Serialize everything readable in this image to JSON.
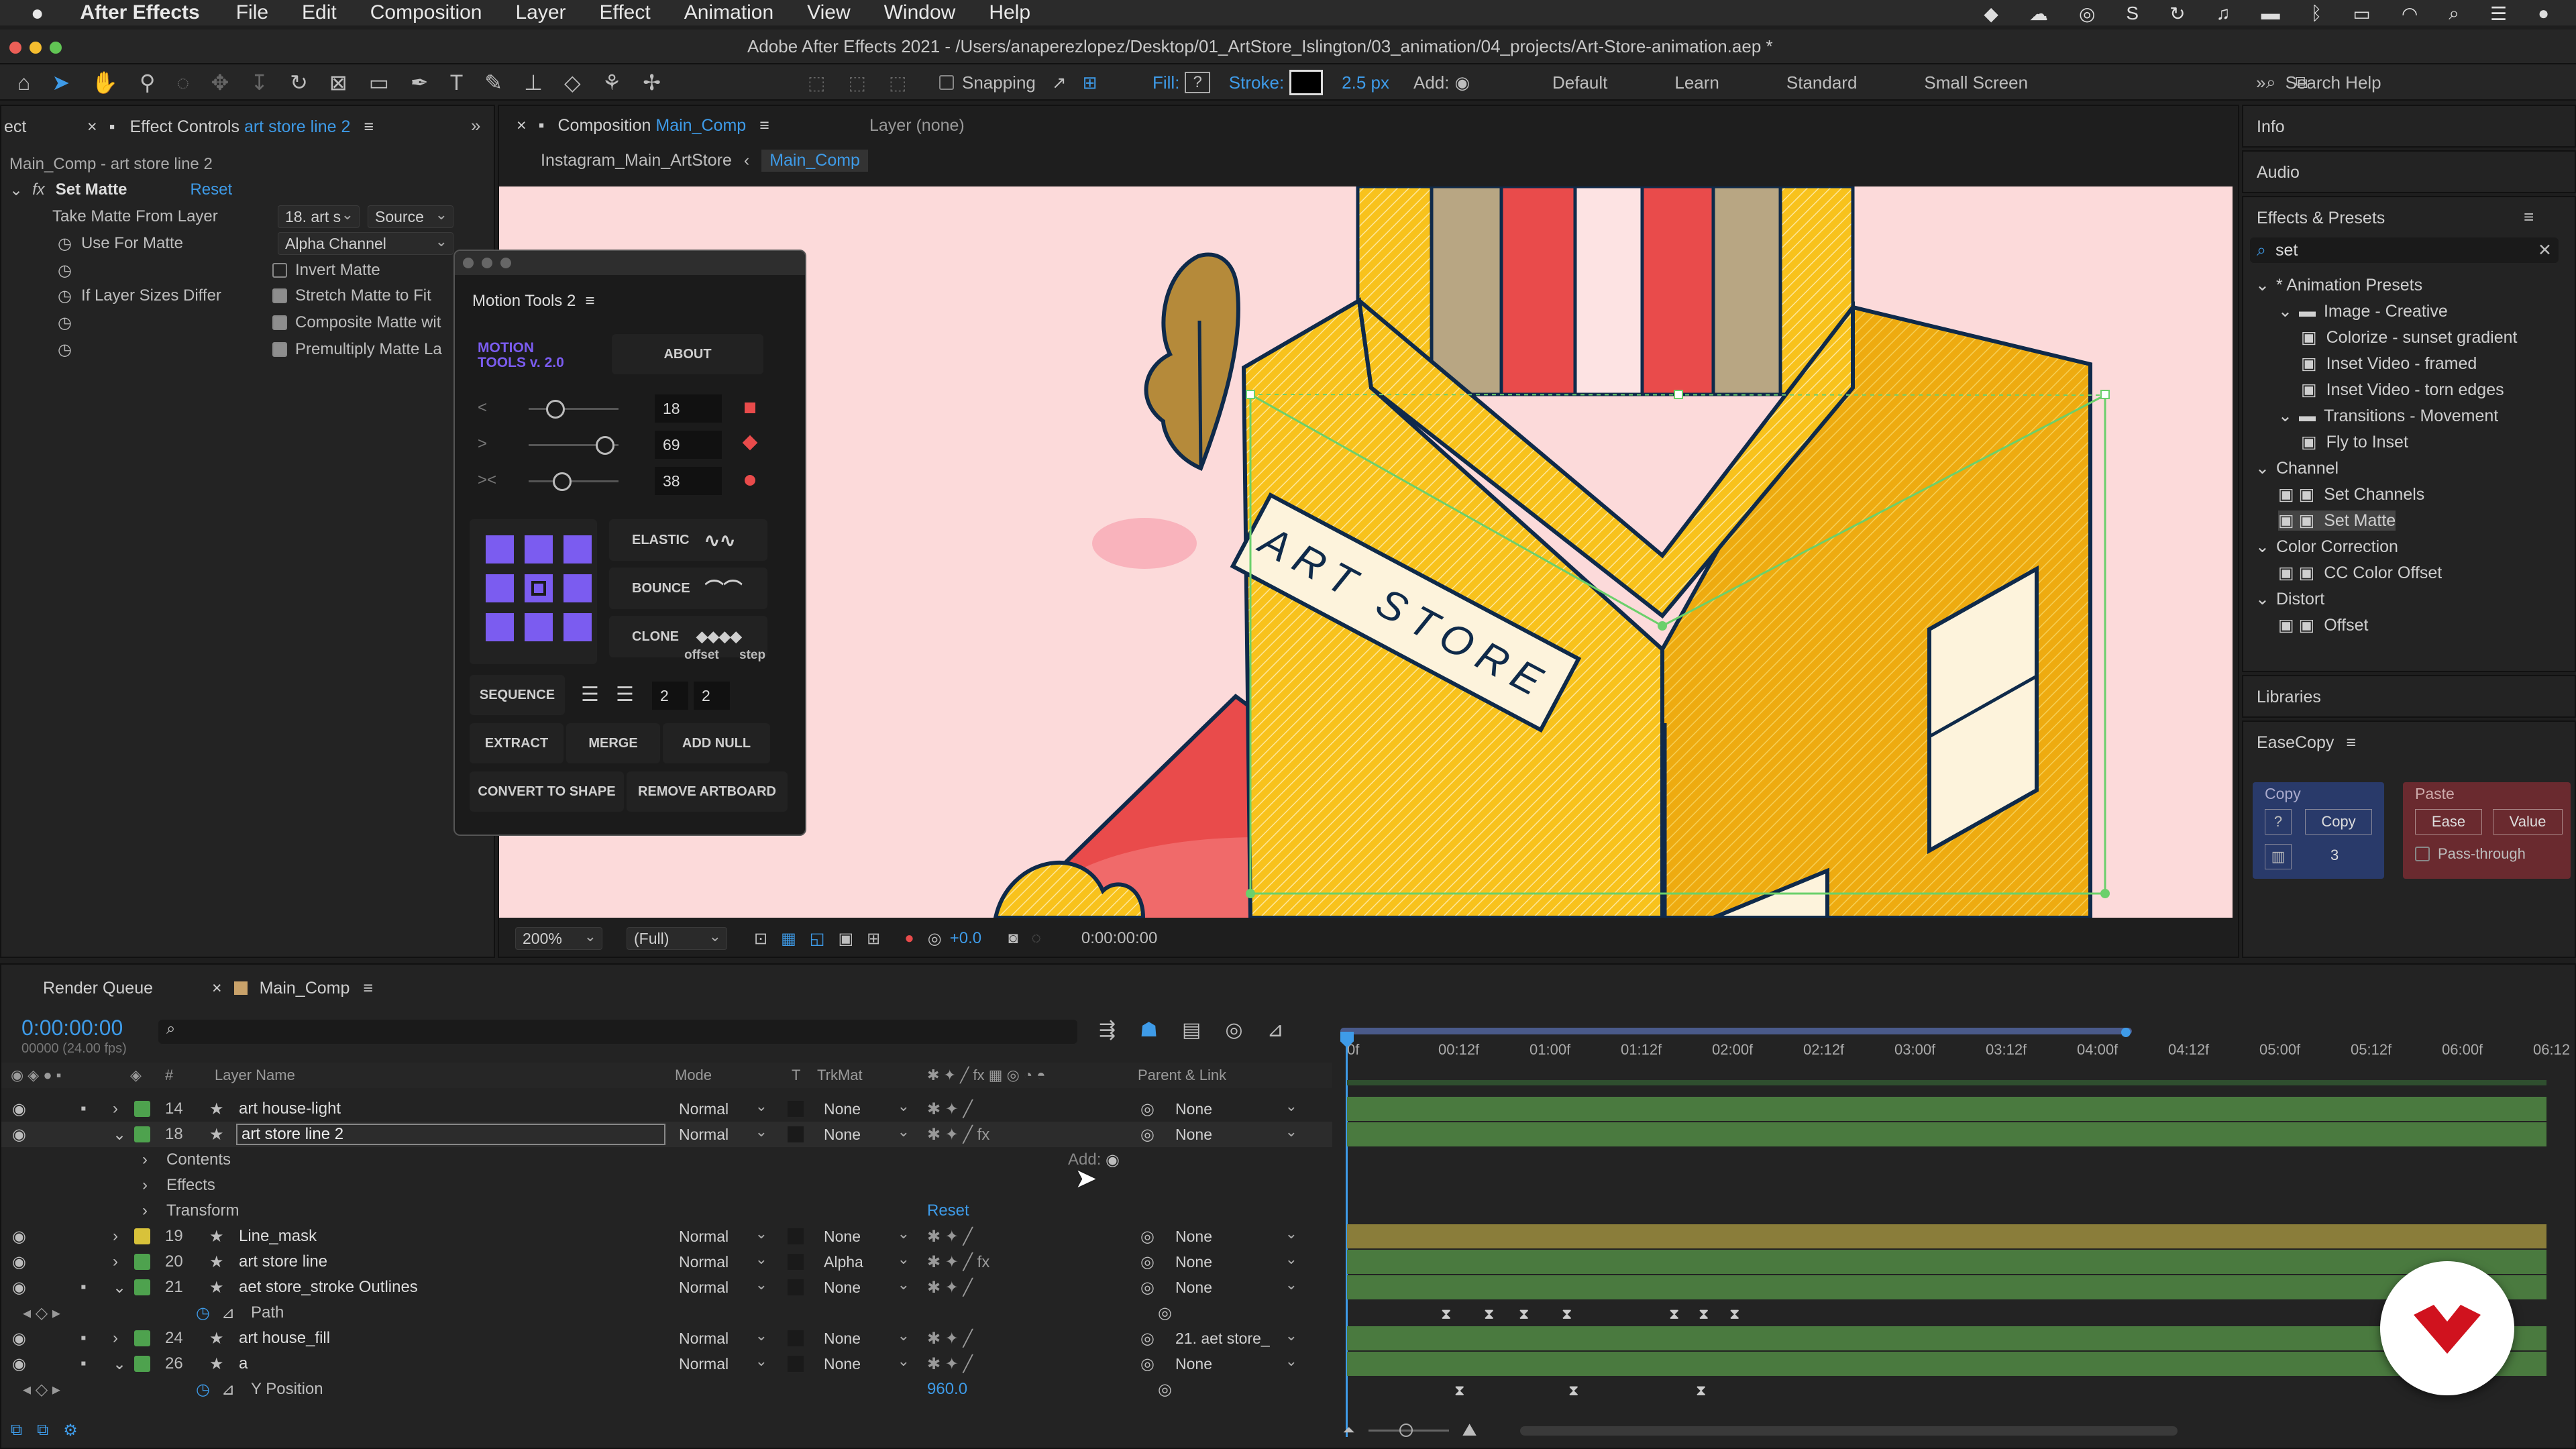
{
  "menubar": {
    "app": "After Effects",
    "items": [
      "File",
      "Edit",
      "Composition",
      "Layer",
      "Effect",
      "Animation",
      "View",
      "Window",
      "Help"
    ]
  },
  "window": {
    "title": "Adobe After Effects 2021 - /Users/anaperezlopez/Desktop/01_ArtStore_Islington/03_animation/04_projects/Art-Store-animation.aep *"
  },
  "toolbar": {
    "snapping": "Snapping",
    "fill": "Fill:",
    "fill_value": "?",
    "stroke": "Stroke:",
    "stroke_px": "2.5 px",
    "add": "Add:",
    "workspaces": [
      "Default",
      "Learn",
      "Standard",
      "Small Screen"
    ],
    "search": "Search Help"
  },
  "effect_controls": {
    "tab_prefix_left": "ect",
    "tab": "Effect Controls",
    "layer": "art store line 2",
    "comp_line": "Main_Comp - art store line 2",
    "effect": "Set Matte",
    "reset": "Reset",
    "props": [
      {
        "label": "Take Matte From Layer",
        "value": "18. art s",
        "source": "Source"
      },
      {
        "label": "Use For Matte",
        "value": "Alpha Channel"
      },
      {
        "label": "",
        "check": "Invert Matte",
        "on": false
      },
      {
        "label": "If Layer Sizes Differ",
        "check": "Stretch Matte to Fit",
        "on": true
      },
      {
        "label": "",
        "check": "Composite Matte wit",
        "on": true
      },
      {
        "label": "",
        "check": "Premultiply Matte La",
        "on": true
      }
    ]
  },
  "composition": {
    "tab": "Composition",
    "comp": "Main_Comp",
    "layer_tab": "Layer (none)",
    "breadcrumb": [
      "Instagram_Main_ArtStore",
      "Main_Comp"
    ],
    "sign": "ART STORE",
    "zoom": "200%",
    "quality": "(Full)",
    "exposure": "+0.0",
    "timecode": "0:00:00:00"
  },
  "motion_tools": {
    "title": "Motion Tools 2",
    "logo": "MOTION TOOLS v. 2.0",
    "about": "ABOUT",
    "sliders": [
      {
        "icon": "<",
        "value": "18"
      },
      {
        "icon": ">",
        "value": "69"
      },
      {
        "icon": "><",
        "value": "38"
      }
    ],
    "elastic": "ELASTIC",
    "bounce": "BOUNCE",
    "clone": "CLONE",
    "offset": "offset",
    "step": "step",
    "sequence": "SEQUENCE",
    "seq_a": "2",
    "seq_b": "2",
    "extract": "EXTRACT",
    "merge": "MERGE",
    "add_null": "ADD NULL",
    "convert": "CONVERT TO SHAPE",
    "remove": "REMOVE ARTBOARD"
  },
  "right": {
    "info": "Info",
    "audio": "Audio",
    "effects_presets": "Effects & Presets",
    "search": "set",
    "tree": [
      {
        "t": "* Animation Presets",
        "lvl": 0,
        "type": "fold"
      },
      {
        "t": "Image - Creative",
        "lvl": 1,
        "type": "folder"
      },
      {
        "t": "Colorize - sunset gradient",
        "lvl": 2,
        "type": "preset"
      },
      {
        "t": "Inset Video - framed",
        "lvl": 2,
        "type": "preset"
      },
      {
        "t": "Inset Video - torn edges",
        "lvl": 2,
        "type": "preset"
      },
      {
        "t": "Transitions - Movement",
        "lvl": 1,
        "type": "folder"
      },
      {
        "t": "Fly to Inset",
        "lvl": 2,
        "type": "preset"
      },
      {
        "t": "Channel",
        "lvl": 0,
        "type": "fold"
      },
      {
        "t": "Set Channels",
        "lvl": 1,
        "type": "fx"
      },
      {
        "t": "Set Matte",
        "lvl": 1,
        "type": "fx",
        "sel": true
      },
      {
        "t": "Color Correction",
        "lvl": 0,
        "type": "fold"
      },
      {
        "t": "CC Color Offset",
        "lvl": 1,
        "type": "fx"
      },
      {
        "t": "Distort",
        "lvl": 0,
        "type": "fold"
      },
      {
        "t": "Offset",
        "lvl": 1,
        "type": "fx"
      }
    ],
    "libraries": "Libraries",
    "easecopy": "EaseCopy",
    "copy": "Copy",
    "copy_btn": "Copy",
    "count": "3",
    "paste": "Paste",
    "ease": "Ease",
    "value": "Value",
    "passthrough": "Pass-through"
  },
  "timeline": {
    "render_queue": "Render Queue",
    "comp": "Main_Comp",
    "timecode": "0:00:00:00",
    "fps": "00000 (24.00 fps)",
    "headers": {
      "name": "Layer Name",
      "mode": "Mode",
      "t": "T",
      "trkmat": "TrkMat",
      "parent": "Parent & Link",
      "num": "#"
    },
    "ruler": [
      "0f",
      "00:12f",
      "01:00f",
      "01:12f",
      "02:00f",
      "02:12f",
      "03:00f",
      "03:12f",
      "04:00f",
      "04:12f",
      "05:00f",
      "05:12f",
      "06:00f",
      "06:12"
    ],
    "layers": [
      {
        "num": "14",
        "name": "art house-light",
        "mode": "Normal",
        "trk": "None",
        "parent": "None",
        "color": "#4ea24e",
        "kind": "layer",
        "locked": true
      },
      {
        "num": "18",
        "name": "art store line 2",
        "mode": "Normal",
        "trk": "None",
        "parent": "None",
        "color": "#4ea24e",
        "kind": "layer-selected",
        "fx": true
      },
      {
        "name": "Contents",
        "kind": "sub",
        "add": "Add:"
      },
      {
        "name": "Effects",
        "kind": "sub"
      },
      {
        "name": "Transform",
        "kind": "sub",
        "reset": "Reset"
      },
      {
        "num": "19",
        "name": "Line_mask",
        "mode": "Normal",
        "trk": "None",
        "parent": "None",
        "color": "#d8c23a",
        "kind": "layer"
      },
      {
        "num": "20",
        "name": "art store line",
        "mode": "Normal",
        "trk": "Alpha",
        "parent": "None",
        "color": "#4ea24e",
        "kind": "layer",
        "fx": true
      },
      {
        "num": "21",
        "name": "aet store_stroke Outlines",
        "mode": "Normal",
        "trk": "None",
        "parent": "None",
        "color": "#4ea24e",
        "kind": "layer",
        "locked": true
      },
      {
        "name": "Path",
        "kind": "prop"
      },
      {
        "num": "24",
        "name": "art house_fill",
        "mode": "Normal",
        "trk": "None",
        "parent": "21. aet store_",
        "color": "#4ea24e",
        "kind": "layer",
        "locked": true
      },
      {
        "num": "26",
        "name": "a",
        "mode": "Normal",
        "trk": "None",
        "parent": "None",
        "color": "#4ea24e",
        "kind": "layer",
        "locked": true
      },
      {
        "name": "Y Position",
        "kind": "prop",
        "value": "960.0"
      }
    ]
  },
  "colors": {
    "accent_blue": "#3e9be8",
    "purple": "#7b5cf0",
    "bg_pink": "#fcdada",
    "yellow": "#f8c21c",
    "red": "#e94b4b",
    "navy": "#0f2a4a"
  }
}
